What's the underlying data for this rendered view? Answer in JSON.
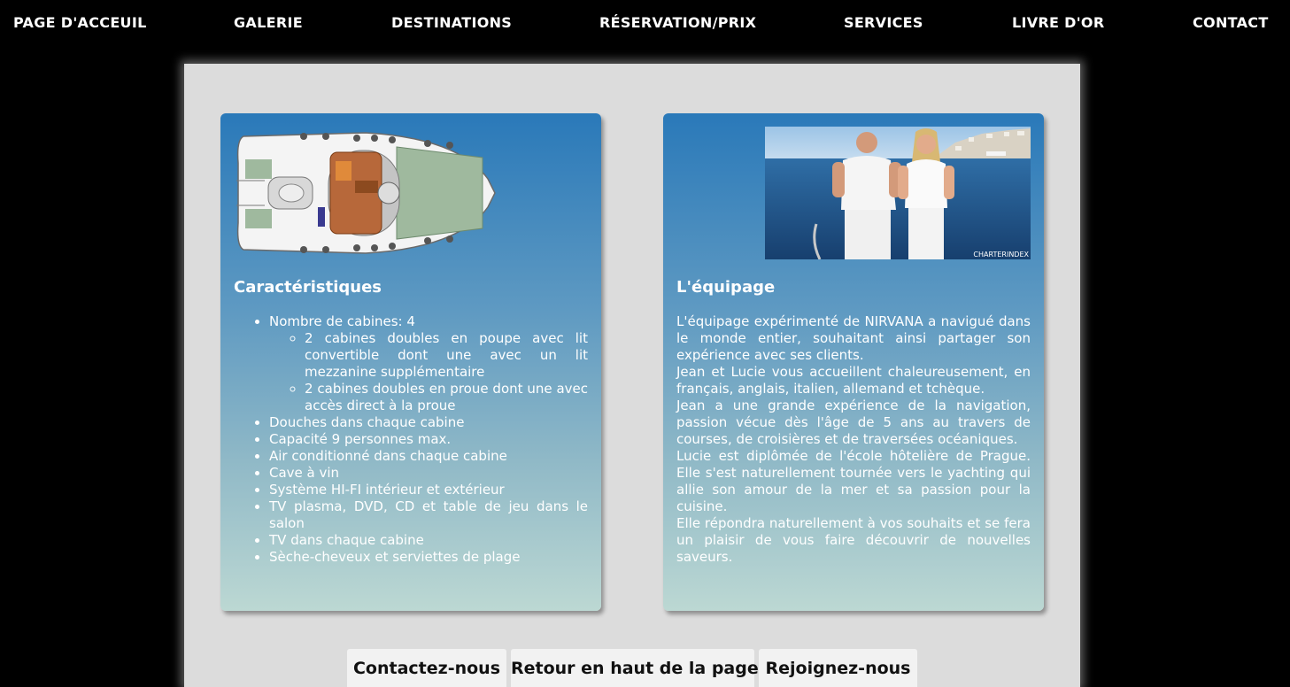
{
  "nav": {
    "items": [
      {
        "label": "PAGE D'ACCEUIL"
      },
      {
        "label": "GALERIE"
      },
      {
        "label": "DESTINATIONS"
      },
      {
        "label": "RÉSERVATION/PRIX"
      },
      {
        "label": "SERVICES"
      },
      {
        "label": "LIVRE D'OR"
      },
      {
        "label": "CONTACT"
      }
    ]
  },
  "characteristics": {
    "title": "Caractéristiques",
    "cabins": "Nombre de cabines: 4",
    "cabin_details": [
      "2 cabines doubles en poupe avec lit convertible dont une avec un lit mezzanine supplémentaire",
      "2 cabines doubles en proue dont une avec accès direct à la proue"
    ],
    "features": [
      "Douches dans chaque cabine",
      "Capacité 9 personnes max.",
      "Air conditionné dans chaque cabine",
      "Cave à vin",
      "Système HI-FI intérieur et extérieur",
      "TV plasma, DVD, CD et table de jeu dans le salon",
      "TV dans chaque cabine",
      "Sèche-cheveux et serviettes de plage"
    ]
  },
  "crew": {
    "title": "L'équipage",
    "photo_watermark": "CHARTERINDEX",
    "paragraphs": [
      "L'équipage expérimenté de NIRVANA a navigué dans le monde entier, souhaitant ainsi partager son expérience avec ses clients.",
      "Jean et Lucie vous accueillent chaleureusement, en français, anglais, italien, allemand et tchèque.",
      "Jean a une grande expérience de la navigation, passion vécue dès l'âge de 5 ans au travers de courses, de croisières et de traversées océaniques.",
      "Lucie est diplômée de l'école hôtelière de Prague. Elle s'est naturellement tournée vers le yachting qui allie son amour de la mer et sa passion pour la cuisine.",
      "Elle répondra naturellement à vos souhaits et se fera un plaisir de vous faire découvrir de nouvelles saveurs."
    ]
  },
  "footer_buttons": {
    "contact": "Contactez-nous",
    "top": "Retour en haut de la page",
    "join": "Rejoignez-nous"
  }
}
